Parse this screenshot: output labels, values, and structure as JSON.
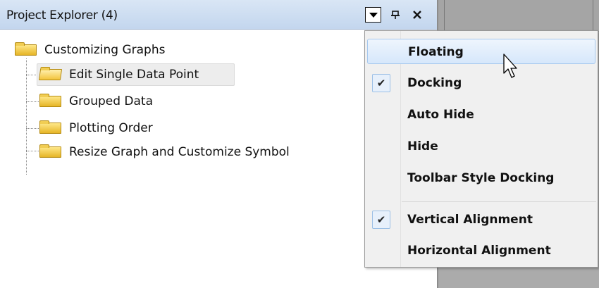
{
  "panel": {
    "title": "Project Explorer (4)",
    "buttons": {
      "dropdown": "dropdown-arrow-icon",
      "pin": "pin-icon",
      "close": "close-icon"
    },
    "pin_glyph": "ᵽ",
    "close_glyph": "✕"
  },
  "tree": {
    "root": {
      "label": "Customizing Graphs"
    },
    "children": [
      {
        "label": "Edit Single Data Point",
        "selected": true,
        "open": true
      },
      {
        "label": "Grouped Data"
      },
      {
        "label": "Plotting Order"
      },
      {
        "label": "Resize Graph and Customize Symbol"
      }
    ]
  },
  "menu": {
    "items": [
      {
        "label": "Floating",
        "hovered": true,
        "checked": false
      },
      {
        "label": "Docking",
        "checked": true
      },
      {
        "label": "Auto Hide",
        "checked": false
      },
      {
        "label": "Hide",
        "checked": false
      },
      {
        "label": "Toolbar Style Docking",
        "checked": false
      },
      {
        "label": "Vertical Alignment",
        "checked": true
      },
      {
        "label": "Horizontal Alignment",
        "checked": false
      }
    ],
    "check_glyph": "✔"
  },
  "colors": {
    "titlebar": "#c9daf0",
    "workspace": "#ababab",
    "menu_bg": "#f0f0f0",
    "hover_border": "#a6c8ee",
    "folder": "#e6b526"
  }
}
